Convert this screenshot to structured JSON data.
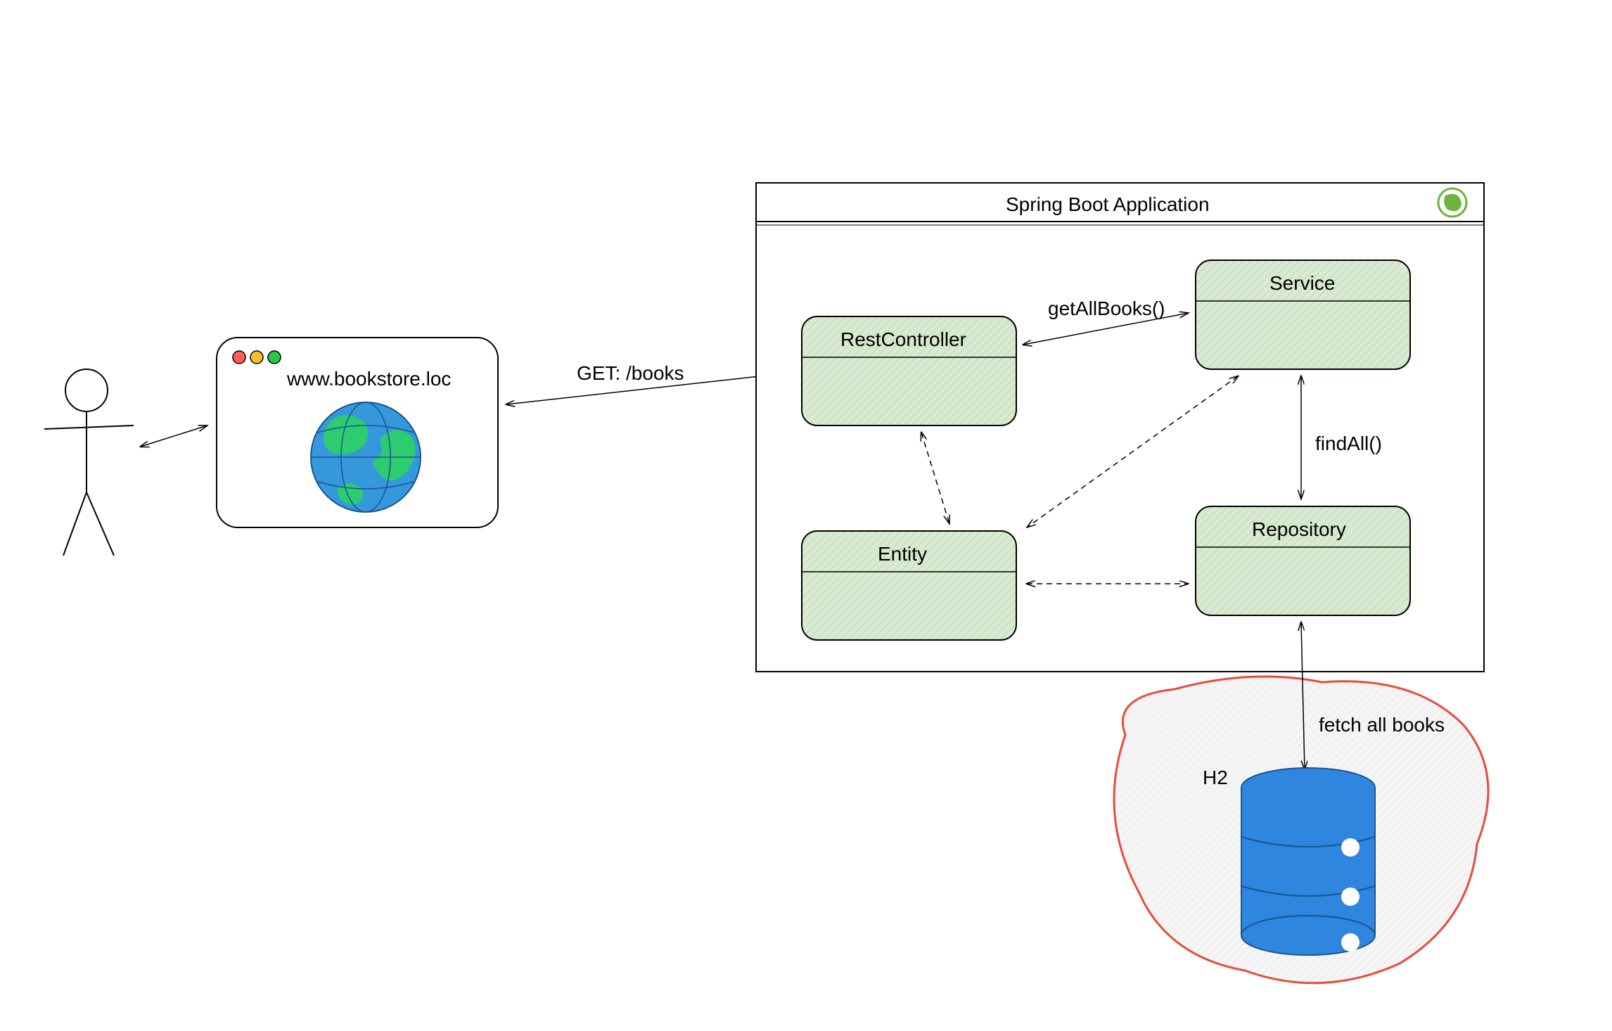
{
  "actor": {
    "label": "User"
  },
  "browser": {
    "url": "www.bookstore.loc"
  },
  "arrows": {
    "user_browser": "",
    "browser_controller": "GET: /books",
    "controller_service": "getAllBooks()",
    "service_repository": "findAll()",
    "repository_db": "fetch all books"
  },
  "app": {
    "title": "Spring Boot Application",
    "components": {
      "controller": "RestController",
      "service": "Service",
      "entity": "Entity",
      "repository": "Repository"
    }
  },
  "db": {
    "label": "H2"
  }
}
